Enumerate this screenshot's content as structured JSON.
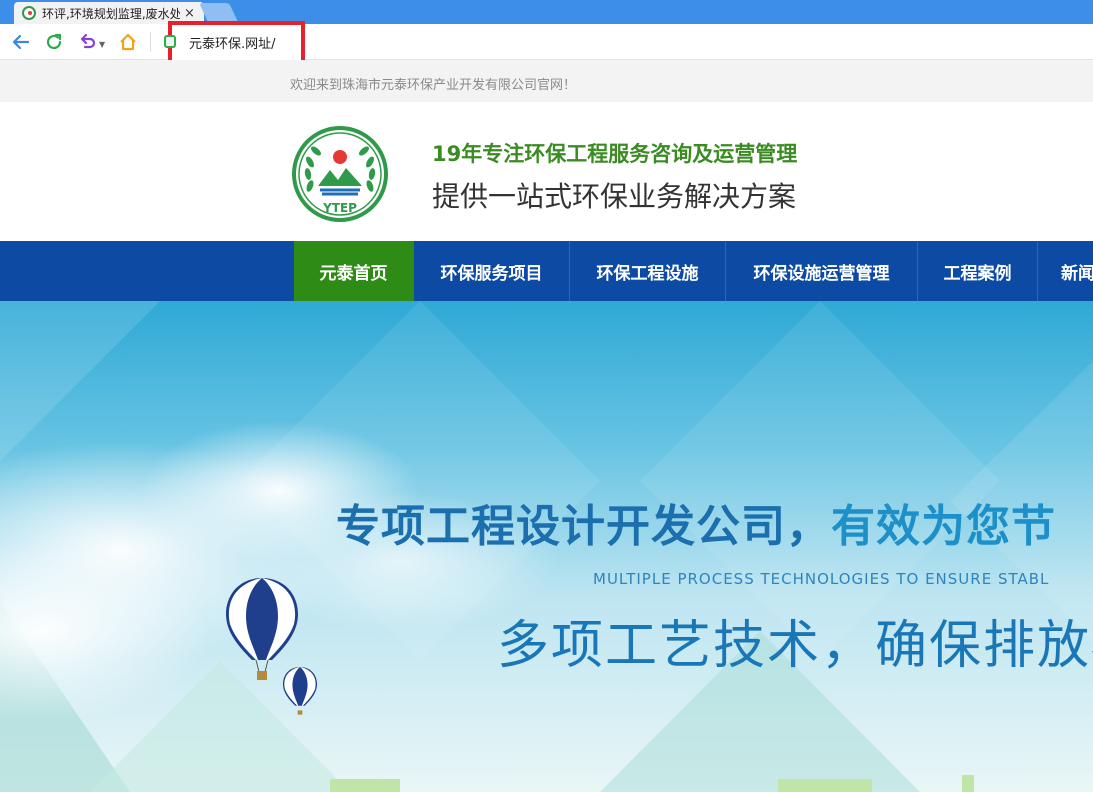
{
  "browser": {
    "tab_title": "环评,环境规划监理,废水处理,环保工程",
    "tab_close": "×",
    "url": "元泰环保.网址/",
    "icons": [
      "back-icon",
      "reload-icon",
      "undo-icon",
      "home-icon",
      "secure-icon"
    ]
  },
  "notice": {
    "text": "欢迎来到珠海市元泰环保产业开发有限公司官网！"
  },
  "header": {
    "logo_text": "YTEP",
    "slogan_line1": "19年专注环保工程服务咨询及运营管理",
    "slogan_line2": "提供一站式环保业务解决方案"
  },
  "nav": {
    "items": [
      {
        "label": "元泰首页",
        "active": true
      },
      {
        "label": "环保服务项目",
        "active": false
      },
      {
        "label": "环保工程设施",
        "active": false
      },
      {
        "label": "环保设施运营管理",
        "active": false
      },
      {
        "label": "工程案例",
        "active": false
      },
      {
        "label": "新闻",
        "active": false
      }
    ]
  },
  "banner": {
    "headline_part1": "专项工程设计开发公司，",
    "headline_part2": "有效为您节",
    "subtitle_en": "MULTIPLE PROCESS TECHNOLOGIES TO ENSURE STABL",
    "headline2": "多项工艺技术，确保排放标"
  },
  "colors": {
    "nav_bg": "#0d4aa3",
    "nav_active": "#2e8b16",
    "slogan_green": "#3a8c22",
    "highlight_red": "#e8202a"
  }
}
